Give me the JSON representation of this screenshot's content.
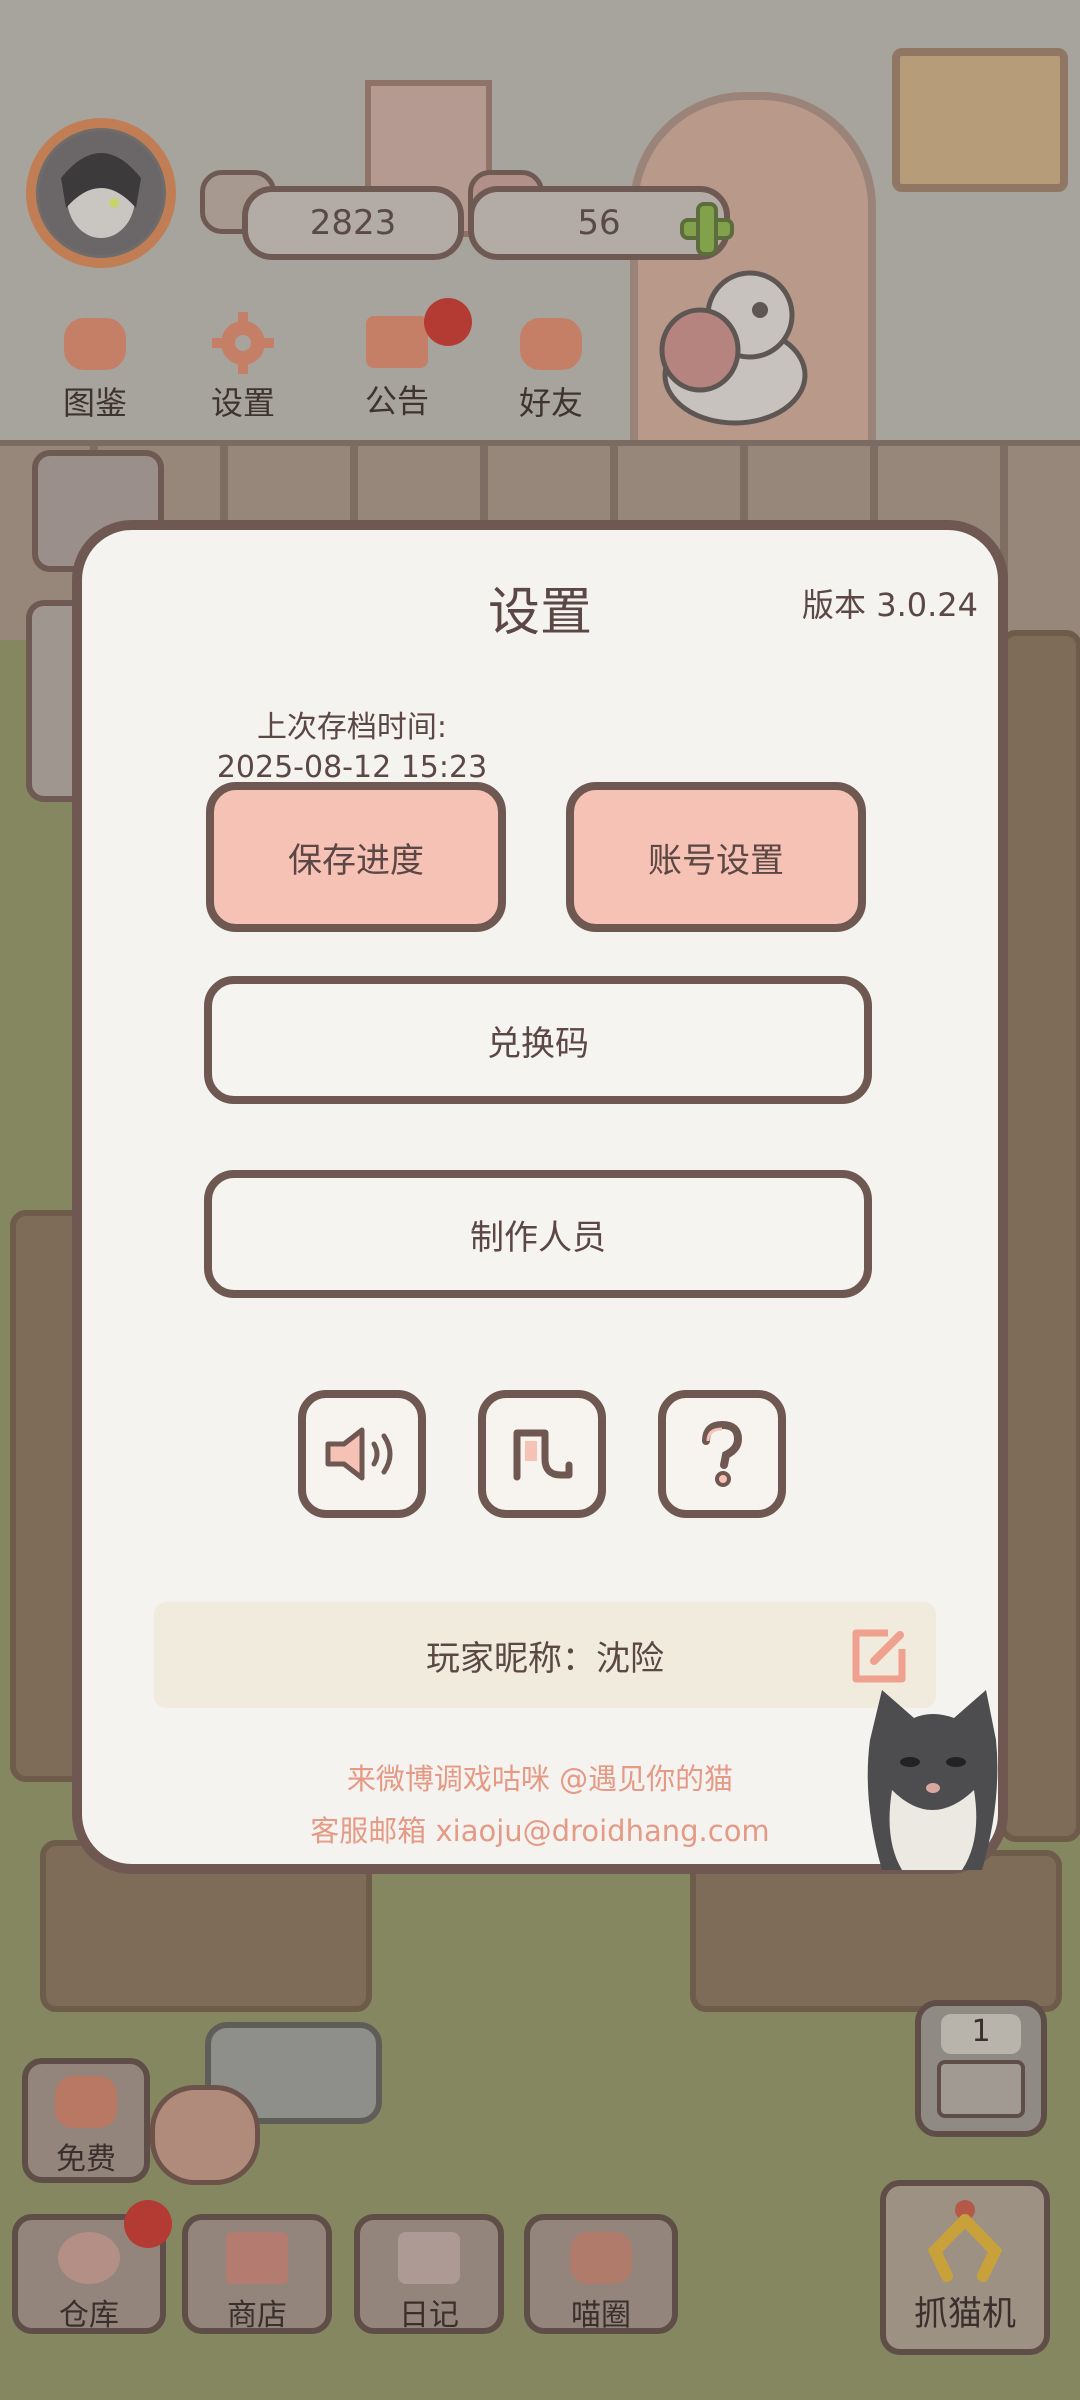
{
  "hud": {
    "fish_count": "2823",
    "heart_count": "56",
    "menu": [
      {
        "label": "图鉴",
        "icon": "cat-face-icon"
      },
      {
        "label": "设置",
        "icon": "gear-icon"
      },
      {
        "label": "公告",
        "icon": "gift-icon"
      },
      {
        "label": "好友",
        "icon": "friends-icon"
      }
    ]
  },
  "settings": {
    "title": "设置",
    "version": "版本 3.0.24",
    "save_time_label": "上次存档时间:",
    "save_time_value": "2025-08-12 15:23",
    "save_button": "保存进度",
    "account_button": "账号设置",
    "redeem_button": "兑换码",
    "credits_button": "制作人员",
    "icons": [
      "sound-icon",
      "music-icon",
      "help-icon"
    ],
    "nickname": "玩家昵称：沈险",
    "weibo_line": "来微博调戏咕咪 @遇见你的猫",
    "email_line": "客服邮箱 xiaoju@droidhang.com"
  },
  "bottom": {
    "free_label": "免费",
    "counter": "1",
    "tabs": [
      {
        "label": "仓库",
        "icon": "warehouse-icon"
      },
      {
        "label": "商店",
        "icon": "shop-icon"
      },
      {
        "label": "日记",
        "icon": "diary-icon"
      },
      {
        "label": "喵圈",
        "icon": "cat-planet-icon"
      }
    ],
    "grab_label": "抓猫机"
  },
  "colors": {
    "panel_border": "#6f5852",
    "pink_button": "#f6c2b5",
    "link_text": "#e59a86"
  }
}
